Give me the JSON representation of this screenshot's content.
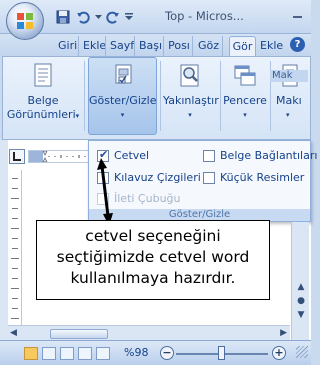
{
  "titlebar": {
    "title": "Top - Micros...",
    "qat": {
      "save_icon": "save-icon",
      "undo_icon": "undo-icon",
      "redo_icon": "redo-icon",
      "customize_icon": "chevron-down-icon"
    }
  },
  "tabs": [
    {
      "label": "Giri"
    },
    {
      "label": "Ekle"
    },
    {
      "label": "Sayf"
    },
    {
      "label": "Başı"
    },
    {
      "label": "Posı"
    },
    {
      "label": "Göz"
    },
    {
      "label": "Gör",
      "active": true
    },
    {
      "label": "Ekle"
    }
  ],
  "help": {
    "label": "?"
  },
  "ribbon": {
    "buttons": [
      {
        "line1": "Belge",
        "line2": "Görünümleri",
        "arrow": "▾"
      },
      {
        "line1": "Göster/Gizle",
        "line2": "",
        "arrow": "▾"
      },
      {
        "line1": "Yakınlaştır",
        "line2": "",
        "arrow": "▾"
      },
      {
        "line1": "Pencere",
        "line2": "",
        "arrow": "▾"
      },
      {
        "line1": "Makı",
        "line2": "",
        "arrow": "▾"
      }
    ],
    "group_label": "Mak"
  },
  "panel": {
    "items": [
      {
        "label": "Cetvel",
        "checked": true,
        "disabled": false
      },
      {
        "label": "Belge Bağlantıları",
        "checked": false,
        "disabled": false
      },
      {
        "label": "Kılavuz Çizgileri",
        "checked": false,
        "disabled": false
      },
      {
        "label": "Küçük Resimler",
        "checked": false,
        "disabled": false
      },
      {
        "label": "İleti Çubuğu",
        "checked": false,
        "disabled": true
      }
    ],
    "footer": "Göster/Gizle"
  },
  "callout": {
    "line1": "cetvel seçeneğini",
    "line2": "seçtiğimizde cetvel word",
    "line3": "kullanılmaya hazırdır."
  },
  "status": {
    "zoom": "%98",
    "zoom_level_percent": 98,
    "minus": "−",
    "plus": "+"
  },
  "colors": {
    "accent": "#15428b",
    "ribbon_bg": "#dfeaf8",
    "pressed": "#a6c4ea"
  }
}
